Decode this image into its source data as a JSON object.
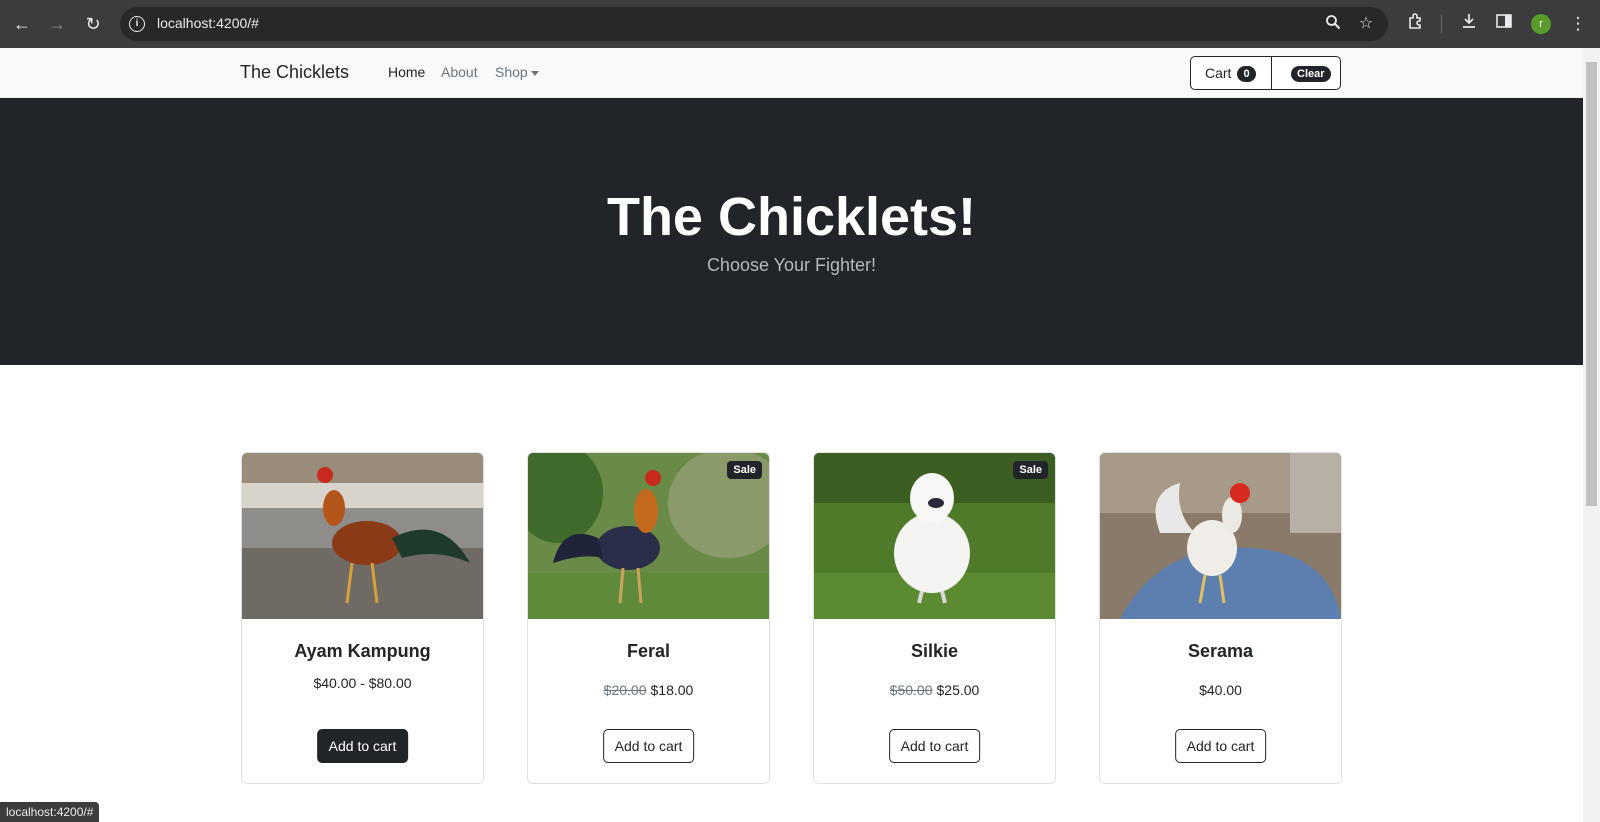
{
  "browser": {
    "url": "localhost:4200/#",
    "avatar_letter": "r"
  },
  "site": {
    "brand": "The Chicklets",
    "nav": [
      {
        "label": "Home"
      },
      {
        "label": "About"
      },
      {
        "label": "Shop"
      }
    ],
    "cart_label": "Cart",
    "cart_count": "0",
    "clear_label": "Clear"
  },
  "hero": {
    "title": "The Chicklets!",
    "subtitle": "Choose Your Fighter!"
  },
  "products": [
    {
      "name": "Ayam Kampung",
      "price": "$40.00 - $80.00",
      "old_price": "",
      "button": "Add to cart",
      "sale": ""
    },
    {
      "name": "Feral",
      "price": "$18.00",
      "old_price": "$20.00",
      "button": "Add to cart",
      "sale": "Sale"
    },
    {
      "name": "Silkie",
      "price": "$25.00",
      "old_price": "$50.00",
      "button": "Add to cart",
      "sale": "Sale"
    },
    {
      "name": "Serama",
      "price": "$40.00",
      "old_price": "",
      "button": "Add to cart",
      "sale": ""
    }
  ],
  "status_bar": "localhost:4200/#",
  "colors": {
    "dark": "#212529",
    "navbar_bg": "#f8f9fa",
    "muted": "#6c757d"
  }
}
